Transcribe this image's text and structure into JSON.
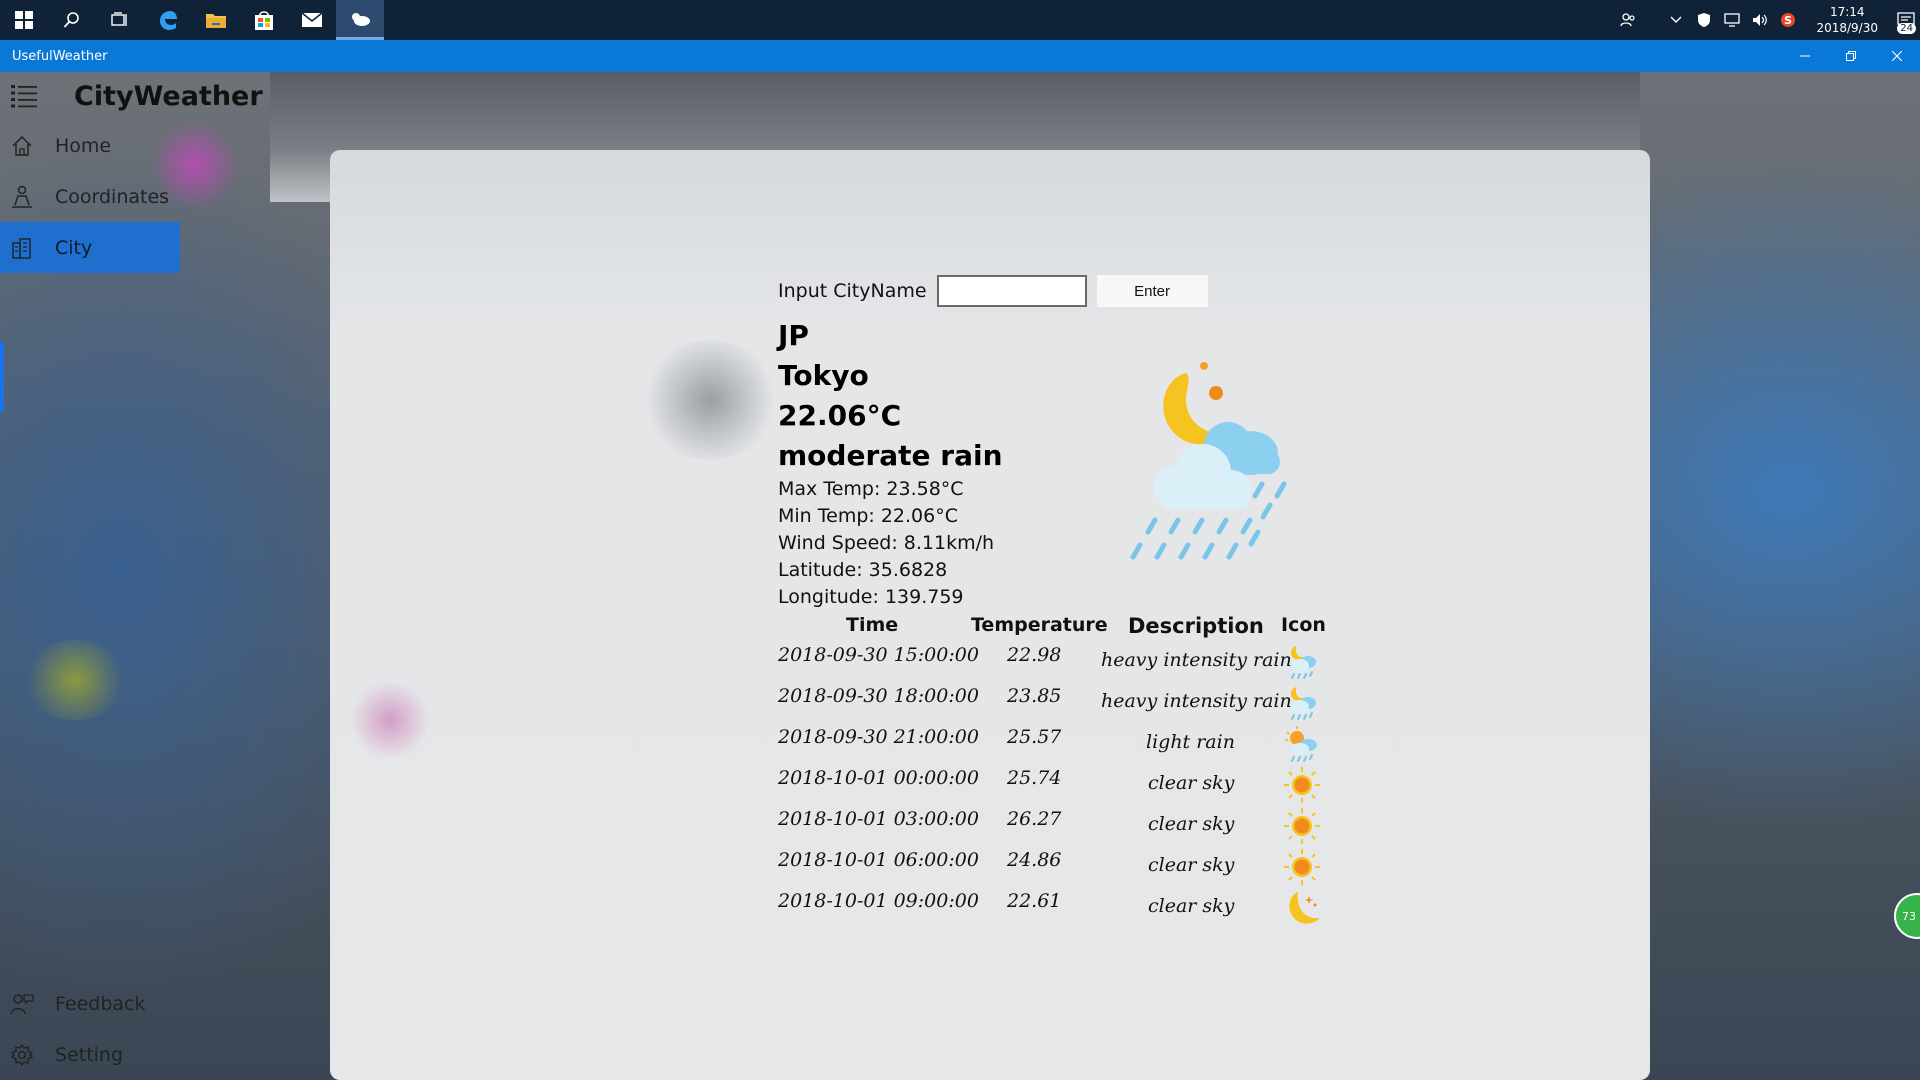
{
  "taskbar": {
    "clock_time": "17:14",
    "clock_date": "2018/9/30",
    "notification_count": "24"
  },
  "window": {
    "title": "UsefulWeather"
  },
  "sidebar": {
    "app_name": "CityWeather",
    "items": [
      {
        "label": "Home",
        "icon": "home-icon"
      },
      {
        "label": "Coordinates",
        "icon": "person-pin-icon"
      },
      {
        "label": "City",
        "icon": "city-icon"
      }
    ],
    "footer": [
      {
        "label": "Feedback",
        "icon": "feedback-icon"
      },
      {
        "label": "Setting",
        "icon": "gear-icon"
      }
    ]
  },
  "search": {
    "label": "Input CityName",
    "value": "",
    "button_label": "Enter"
  },
  "current": {
    "country": "JP",
    "city": "Tokyo",
    "temperature": "22.06°C",
    "description": "moderate rain",
    "max_temp": "Max Temp:  23.58°C",
    "min_temp": "Min Temp:  22.06°C",
    "wind_speed": "Wind Speed:  8.11km/h",
    "latitude": "Latitude:  35.6828",
    "longitude": "Longitude:  139.759",
    "icon": "night-rain-icon"
  },
  "forecast": {
    "headers": {
      "time": "Time",
      "temperature": "Temperature",
      "description": "Description",
      "icon": "Icon"
    },
    "rows": [
      {
        "time": "2018-09-30 15:00:00",
        "temp": "22.98",
        "desc": "heavy intensity rain",
        "icon": "night-rain"
      },
      {
        "time": "2018-09-30 18:00:00",
        "temp": "23.85",
        "desc": "heavy intensity rain",
        "icon": "night-rain"
      },
      {
        "time": "2018-09-30 21:00:00",
        "temp": "25.57",
        "desc": "light rain",
        "icon": "day-rain"
      },
      {
        "time": "2018-10-01 00:00:00",
        "temp": "25.74",
        "desc": "clear sky",
        "icon": "sun"
      },
      {
        "time": "2018-10-01 03:00:00",
        "temp": "26.27",
        "desc": "clear sky",
        "icon": "sun"
      },
      {
        "time": "2018-10-01 06:00:00",
        "temp": "24.86",
        "desc": "clear sky",
        "icon": "sun"
      },
      {
        "time": "2018-10-01 09:00:00",
        "temp": "22.61",
        "desc": "clear sky",
        "icon": "moon"
      }
    ]
  },
  "overlay_badge": "73",
  "colors": {
    "titlebar": "#0a78d7",
    "taskbar": "#0f2238",
    "nav_selected": "#1f6fcf"
  }
}
